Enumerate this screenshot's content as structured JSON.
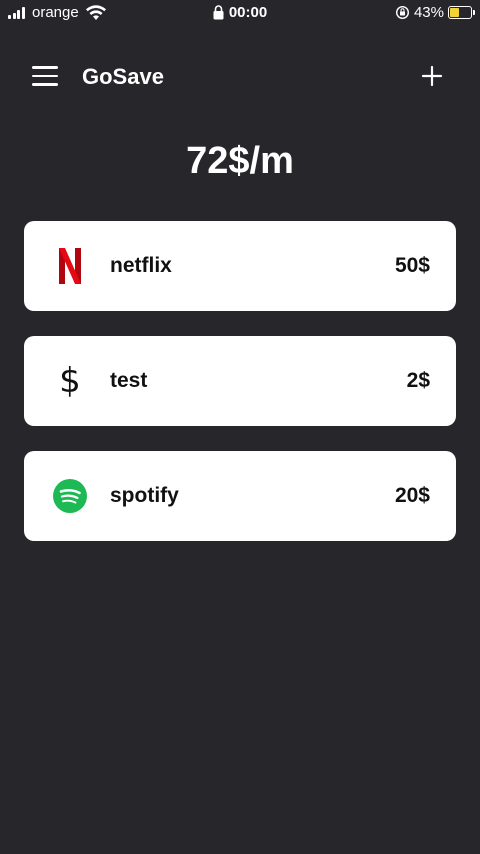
{
  "status_bar": {
    "carrier": "orange",
    "time": "00:00",
    "battery_percent": "43%",
    "battery_level": 0.43,
    "battery_color": "#f2d235",
    "icons": [
      "signal-icon",
      "wifi-icon",
      "lock-icon",
      "orientation-lock-icon",
      "battery-icon"
    ]
  },
  "header": {
    "title": "GoSave",
    "menu_icon": "hamburger-menu-icon",
    "add_icon": "plus-icon"
  },
  "total": {
    "label": "72$/m"
  },
  "subscriptions": [
    {
      "name": "netflix",
      "price": "50$",
      "icon": "netflix-icon",
      "icon_color": "#e50914"
    },
    {
      "name": "test",
      "price": "2$",
      "icon": "dollar-icon",
      "icon_color": "#111111"
    },
    {
      "name": "spotify",
      "price": "20$",
      "icon": "spotify-icon",
      "icon_color": "#1db954"
    }
  ],
  "colors": {
    "background": "#27262b",
    "card": "#ffffff",
    "text_light": "#ffffff",
    "text_dark": "#111111"
  }
}
